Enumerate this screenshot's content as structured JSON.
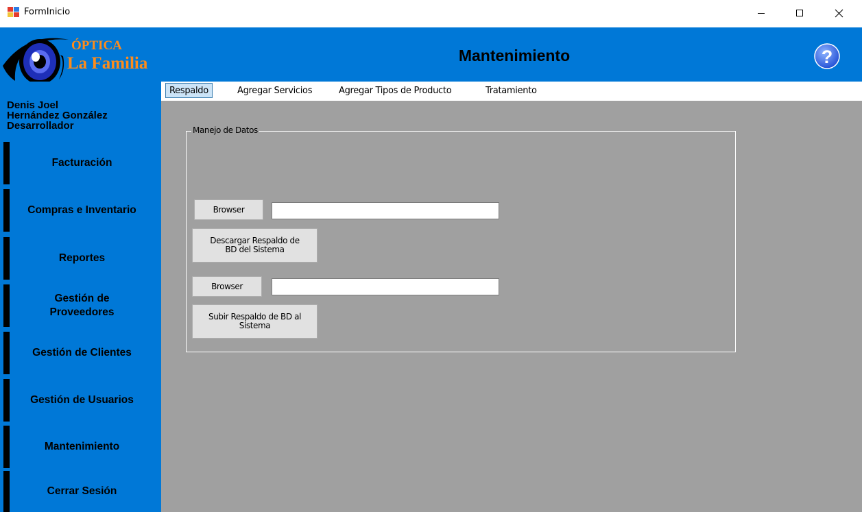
{
  "window": {
    "title": "FormInicio"
  },
  "header": {
    "logo": {
      "brand_top": "ÓPTICA",
      "brand_bottom": "La Familia"
    },
    "title": "Mantenimiento",
    "help_icon": "question-circle-icon"
  },
  "sidebar": {
    "user": {
      "first_name": "Denis Joel",
      "last_name": "Hernández González",
      "role": "Desarrollador"
    },
    "items": [
      {
        "label": "Facturación"
      },
      {
        "label": "Compras e Inventario"
      },
      {
        "label": "Reportes"
      },
      {
        "label_line1": "Gestión de",
        "label_line2": "Proveedores"
      },
      {
        "label": "Gestión de Clientes"
      },
      {
        "label": "Gestión de Usuarios"
      },
      {
        "label": "Mantenimiento"
      },
      {
        "label": "Cerrar Sesión"
      }
    ]
  },
  "tabs": [
    {
      "label": "Respaldo",
      "active": true
    },
    {
      "label": "Agregar Servicios",
      "active": false
    },
    {
      "label": "Agregar Tipos de Producto",
      "active": false
    },
    {
      "label": "Tratamiento",
      "active": false
    }
  ],
  "backup_panel": {
    "group_title": "Manejo de Datos",
    "browse_1": {
      "label": "Browser",
      "path_value": ""
    },
    "download_button": {
      "line1": "Descargar Respaldo de",
      "line2": "BD del Sistema"
    },
    "browse_2": {
      "label": "Browser",
      "path_value": ""
    },
    "upload_button": {
      "line1": "Subir Respaldo  de BD al",
      "line2": "Sistema"
    }
  },
  "colors": {
    "header_blue": "#0078d7",
    "content_gray": "#a0a0a0",
    "logo_text": "#ff8c1a"
  }
}
